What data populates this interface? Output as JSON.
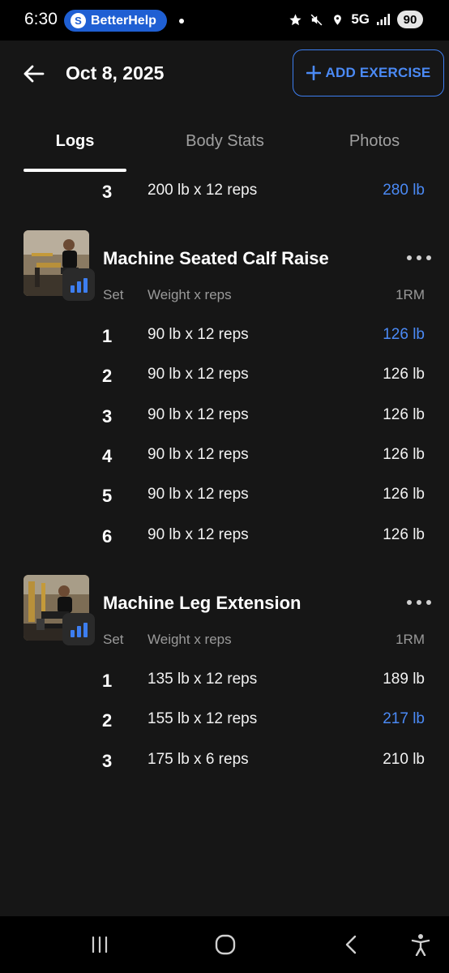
{
  "status_bar": {
    "time": "6:30",
    "notification_app": "BetterHelp",
    "network": "5G",
    "battery": "90"
  },
  "header": {
    "title": "Oct 8, 2025",
    "add_button_label": "ADD EXERCISE",
    "back_icon": "arrow-left-icon"
  },
  "tabs": [
    {
      "label": "Logs",
      "active": true
    },
    {
      "label": "Body Stats",
      "active": false
    },
    {
      "label": "Photos",
      "active": false
    }
  ],
  "previous_row": {
    "set": "3",
    "weight_reps": "200 lb x 12 reps",
    "rm": "280 lb",
    "pr": true
  },
  "exercises": [
    {
      "name": "Machine Seated Calf Raise",
      "columns": {
        "set": "Set",
        "weight_reps": "Weight x reps",
        "rm": "1RM"
      },
      "sets": [
        {
          "set": "1",
          "weight_reps": "90 lb x 12 reps",
          "rm": "126 lb",
          "pr": true
        },
        {
          "set": "2",
          "weight_reps": "90 lb x 12 reps",
          "rm": "126 lb",
          "pr": false
        },
        {
          "set": "3",
          "weight_reps": "90 lb x 12 reps",
          "rm": "126 lb",
          "pr": false
        },
        {
          "set": "4",
          "weight_reps": "90 lb x 12 reps",
          "rm": "126 lb",
          "pr": false
        },
        {
          "set": "5",
          "weight_reps": "90 lb x 12 reps",
          "rm": "126 lb",
          "pr": false
        },
        {
          "set": "6",
          "weight_reps": "90 lb x 12 reps",
          "rm": "126 lb",
          "pr": false
        }
      ]
    },
    {
      "name": "Machine Leg Extension",
      "columns": {
        "set": "Set",
        "weight_reps": "Weight x reps",
        "rm": "1RM"
      },
      "sets": [
        {
          "set": "1",
          "weight_reps": "135 lb x 12 reps",
          "rm": "189 lb",
          "pr": false
        },
        {
          "set": "2",
          "weight_reps": "155 lb x 12 reps",
          "rm": "217 lb",
          "pr": true
        },
        {
          "set": "3",
          "weight_reps": "175 lb x 6 reps",
          "rm": "210 lb",
          "pr": false
        }
      ]
    }
  ],
  "colors": {
    "accent": "#4b8af5",
    "background": "#161616",
    "text": "#ffffff",
    "muted": "#9a9a9a"
  }
}
